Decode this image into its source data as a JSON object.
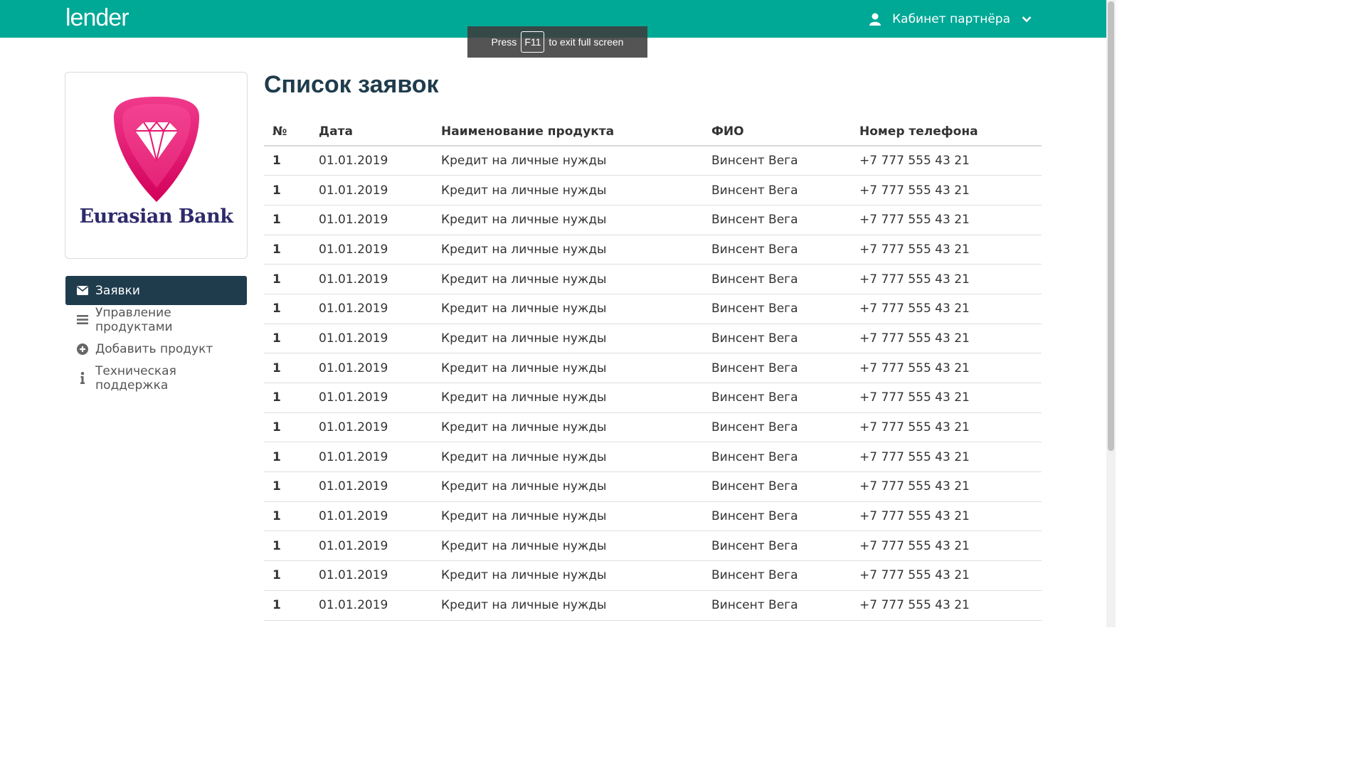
{
  "header": {
    "brand": "lender",
    "partner_label": "Кабинет партнёра"
  },
  "fullscreen_toast": {
    "press": "Press",
    "key": "F11",
    "rest": "to exit full screen"
  },
  "logo": {
    "text": "Eurasian Bank"
  },
  "sidebar": {
    "items": [
      {
        "label": "Заявки",
        "icon": "envelope-icon",
        "active": true
      },
      {
        "label": "Управление продуктами",
        "icon": "list-icon",
        "active": false
      },
      {
        "label": "Добавить продукт",
        "icon": "plus-circle-icon",
        "active": false
      },
      {
        "label": "Техническая поддержка",
        "icon": "info-icon",
        "active": false
      }
    ]
  },
  "main": {
    "title": "Список заявок",
    "columns": [
      "№",
      "Дата",
      "Наименование продукта",
      "ФИО",
      "Номер телефона"
    ],
    "rows": [
      [
        "1",
        "01.01.2019",
        "Кредит на личные нужды",
        "Винсент Вега",
        "+7 777 555 43 21"
      ],
      [
        "1",
        "01.01.2019",
        "Кредит на личные нужды",
        "Винсент Вега",
        "+7 777 555 43 21"
      ],
      [
        "1",
        "01.01.2019",
        "Кредит на личные нужды",
        "Винсент Вега",
        "+7 777 555 43 21"
      ],
      [
        "1",
        "01.01.2019",
        "Кредит на личные нужды",
        "Винсент Вега",
        "+7 777 555 43 21"
      ],
      [
        "1",
        "01.01.2019",
        "Кредит на личные нужды",
        "Винсент Вега",
        "+7 777 555 43 21"
      ],
      [
        "1",
        "01.01.2019",
        "Кредит на личные нужды",
        "Винсент Вега",
        "+7 777 555 43 21"
      ],
      [
        "1",
        "01.01.2019",
        "Кредит на личные нужды",
        "Винсент Вега",
        "+7 777 555 43 21"
      ],
      [
        "1",
        "01.01.2019",
        "Кредит на личные нужды",
        "Винсент Вега",
        "+7 777 555 43 21"
      ],
      [
        "1",
        "01.01.2019",
        "Кредит на личные нужды",
        "Винсент Вега",
        "+7 777 555 43 21"
      ],
      [
        "1",
        "01.01.2019",
        "Кредит на личные нужды",
        "Винсент Вега",
        "+7 777 555 43 21"
      ],
      [
        "1",
        "01.01.2019",
        "Кредит на личные нужды",
        "Винсент Вега",
        "+7 777 555 43 21"
      ],
      [
        "1",
        "01.01.2019",
        "Кредит на личные нужды",
        "Винсент Вега",
        "+7 777 555 43 21"
      ],
      [
        "1",
        "01.01.2019",
        "Кредит на личные нужды",
        "Винсент Вега",
        "+7 777 555 43 21"
      ],
      [
        "1",
        "01.01.2019",
        "Кредит на личные нужды",
        "Винсент Вега",
        "+7 777 555 43 21"
      ],
      [
        "1",
        "01.01.2019",
        "Кредит на личные нужды",
        "Винсент Вега",
        "+7 777 555 43 21"
      ],
      [
        "1",
        "01.01.2019",
        "Кредит на личные нужды",
        "Винсент Вега",
        "+7 777 555 43 21"
      ]
    ]
  },
  "colors": {
    "header": "#00a896",
    "active_nav": "#1f3c4d",
    "title": "#1f3c4d",
    "logo_pink": "#e8156e"
  }
}
